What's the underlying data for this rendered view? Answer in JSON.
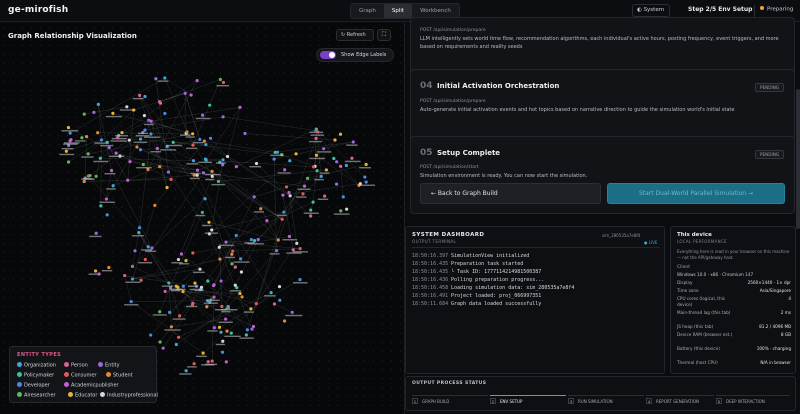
{
  "app": {
    "brand": "ge-mirofish"
  },
  "view_tabs": [
    {
      "label": "Graph",
      "active": false
    },
    {
      "label": "Split",
      "active": true
    },
    {
      "label": "Workbench",
      "active": false
    }
  ],
  "header": {
    "system_label": "System",
    "step_label": "Step 2/5  Env Setup",
    "status_label": "Preparing",
    "status_color": "#f0a33a"
  },
  "graph": {
    "title": "Graph Relationship Visualization",
    "refresh_label": "Refresh",
    "edge_toggle_label": "Show Edge Labels",
    "edge_toggle_on": true,
    "legend": {
      "title": "ENTITY TYPES",
      "items": [
        {
          "label": "Organization",
          "color": "#3fa7d6"
        },
        {
          "label": "Person",
          "color": "#e0609a"
        },
        {
          "label": "Entity",
          "color": "#9b6ae0"
        },
        {
          "label": "Policymaker",
          "color": "#3fbf9f"
        },
        {
          "label": "Consumer",
          "color": "#e05b5b"
        },
        {
          "label": "Student",
          "color": "#e08a3a"
        },
        {
          "label": "Developer",
          "color": "#4a8de0"
        },
        {
          "label": "Academicpublisher",
          "color": "#c45fd0"
        },
        {
          "label": "Airesearcher",
          "color": "#5fb85a"
        },
        {
          "label": "Educator",
          "color": "#e8b13a"
        },
        {
          "label": "Industryprofessional",
          "color": "#d6d6d6"
        }
      ]
    }
  },
  "steps": [
    {
      "endpoint": "POST /api/simulation/prepare",
      "description": "LLM intelligently sets world time flow, recommendation algorithms, each individual's active hours, posting frequency, event triggers, and more based on requirements and reality seeds"
    },
    {
      "number": "04",
      "title": "Initial Activation Orchestration",
      "badge": "PENDING",
      "endpoint": "POST /api/simulation/prepare",
      "description": "Auto-generate initial activation events and hot topics based on narrative direction to guide the simulation world's initial state"
    },
    {
      "number": "05",
      "title": "Setup Complete",
      "badge": "PENDING",
      "endpoint": "POST /api/simulation/start",
      "description": "Simulation environment is ready. You can now start the simulation.",
      "back_label": "← Back to Graph Build",
      "start_label": "Start Dual-World Parallel Simulation →"
    }
  ],
  "dashboard": {
    "title": "SYSTEM DASHBOARD",
    "subtitle": "OUTPUT TERMINAL",
    "sim_id": "sim_280535a7e8f4",
    "live_label": "● LIVE",
    "logs": [
      {
        "time": "18:50:16.397",
        "text": "SimulationView initialized"
      },
      {
        "time": "18:50:16.435",
        "text": "Preparation task started"
      },
      {
        "time": "18:50:16.435",
        "text": "└ Task ID: 1777114214981500387"
      },
      {
        "time": "18:50:16.436",
        "text": "Polling preparation progress..."
      },
      {
        "time": "18:50:16.458",
        "text": "Loading simulation data: sim_280535a7e8f4"
      },
      {
        "time": "18:50:16.491",
        "text": "Project loaded: proj_066997351"
      },
      {
        "time": "18:50:11.684",
        "text": "Graph data loaded successfully"
      }
    ]
  },
  "device": {
    "title": "This device",
    "subtitle": "LOCAL PERFORMANCE",
    "note": "Everything here is read in your browser on this machine — not the API/gateway host.",
    "section": "Client",
    "user_agent": "Windows 10.0 · x86 · Chromium 147",
    "rows": [
      {
        "key": "Display",
        "value": "2560×1440 · 1× dpr"
      },
      {
        "key": "Time zone",
        "value": "Asia/Singapore"
      },
      {
        "key": "CPU cores (logical, this device)",
        "value": "4"
      },
      {
        "key": "Main-thread lag (this tab)",
        "value": "2 ms"
      },
      {
        "key": "JS heap (this tab)",
        "value": "81.2 / 4096 MB"
      },
      {
        "key": "Device RAM (browser est.)",
        "value": "8 GB"
      },
      {
        "key": "Battery (this device)",
        "value": "100% · charging"
      },
      {
        "key": "Thermal (host CPU)",
        "value": "N/A in browser"
      }
    ]
  },
  "process": {
    "title": "OUTPUT PROCESS STATUS",
    "steps": [
      {
        "num": "1",
        "label": "GRAPH BUILD",
        "active": false
      },
      {
        "num": "2",
        "label": "ENV SETUP",
        "active": true
      },
      {
        "num": "3",
        "label": "RUN SIMULATION",
        "active": false
      },
      {
        "num": "4",
        "label": "REPORT GENERATION",
        "active": false
      },
      {
        "num": "5",
        "label": "DEEP INTERACTION",
        "active": false
      }
    ]
  }
}
